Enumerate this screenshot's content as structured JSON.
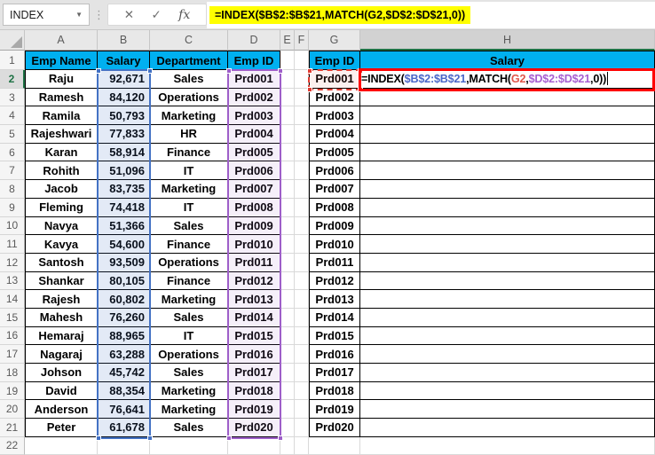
{
  "formula_bar": {
    "name_box": "INDEX",
    "formula": "=INDEX($B$2:$B$21,MATCH(G2,$D$2:$D$21,0))"
  },
  "icons": {
    "cancel": "✕",
    "enter": "✓",
    "insert_function": "fx",
    "name_box_dropdown": "▼"
  },
  "grid": {
    "column_letters": [
      "A",
      "B",
      "C",
      "D",
      "E",
      "F",
      "G",
      "H"
    ],
    "active_column": "H",
    "active_row": 2,
    "row_count": 22
  },
  "left_table": {
    "headers": [
      "Emp Name",
      "Salary",
      "Department",
      "Emp ID"
    ],
    "rows": [
      [
        "Raju",
        "92,671",
        "Sales",
        "Prd001"
      ],
      [
        "Ramesh",
        "84,120",
        "Operations",
        "Prd002"
      ],
      [
        "Ramila",
        "50,793",
        "Marketing",
        "Prd003"
      ],
      [
        "Rajeshwari",
        "77,833",
        "HR",
        "Prd004"
      ],
      [
        "Karan",
        "58,914",
        "Finance",
        "Prd005"
      ],
      [
        "Rohith",
        "51,096",
        "IT",
        "Prd006"
      ],
      [
        "Jacob",
        "83,735",
        "Marketing",
        "Prd007"
      ],
      [
        "Fleming",
        "74,418",
        "IT",
        "Prd008"
      ],
      [
        "Navya",
        "51,366",
        "Sales",
        "Prd009"
      ],
      [
        "Kavya",
        "54,600",
        "Finance",
        "Prd010"
      ],
      [
        "Santosh",
        "93,509",
        "Operations",
        "Prd011"
      ],
      [
        "Shankar",
        "80,105",
        "Finance",
        "Prd012"
      ],
      [
        "Rajesh",
        "60,802",
        "Marketing",
        "Prd013"
      ],
      [
        "Mahesh",
        "76,260",
        "Sales",
        "Prd014"
      ],
      [
        "Hemaraj",
        "88,965",
        "IT",
        "Prd015"
      ],
      [
        "Nagaraj",
        "63,288",
        "Operations",
        "Prd016"
      ],
      [
        "Johson",
        "45,742",
        "Sales",
        "Prd017"
      ],
      [
        "David",
        "88,354",
        "Marketing",
        "Prd018"
      ],
      [
        "Anderson",
        "76,641",
        "Marketing",
        "Prd019"
      ],
      [
        "Peter",
        "61,678",
        "Sales",
        "Prd020"
      ]
    ]
  },
  "right_table": {
    "headers": [
      "Emp ID",
      "Salary"
    ],
    "ids": [
      "Prd001",
      "Prd002",
      "Prd003",
      "Prd004",
      "Prd005",
      "Prd006",
      "Prd007",
      "Prd008",
      "Prd009",
      "Prd010",
      "Prd011",
      "Prd012",
      "Prd013",
      "Prd014",
      "Prd015",
      "Prd016",
      "Prd017",
      "Prd018",
      "Prd019",
      "Prd020"
    ],
    "active_cell_formula_parts": [
      {
        "text": "=INDEX(",
        "color": "#000000"
      },
      {
        "text": "$B$2:$B$21",
        "color": "#4a67c8"
      },
      {
        "text": ",MATCH(",
        "color": "#000000"
      },
      {
        "text": "G2",
        "color": "#e0564b"
      },
      {
        "text": ",",
        "color": "#000000"
      },
      {
        "text": "$D$2:$D$21",
        "color": "#a75fd1"
      },
      {
        "text": ",0",
        "color": "#000000"
      },
      {
        "text": "))",
        "color": "#000000"
      }
    ]
  },
  "colors": {
    "header_fill": "#00b0f0",
    "formula_highlight": "#ffff00",
    "active_green": "#1f7245",
    "range_blue": "#4472c4",
    "range_blue_fill": "rgba(68,114,196,0.15)",
    "range_purple": "#9e5fc9",
    "range_purple_fill": "rgba(158,95,201,0.10)",
    "range_red": "#e23c32",
    "range_red_fill": "rgba(226,60,50,0.08)",
    "annotation_red": "#ff0000"
  }
}
